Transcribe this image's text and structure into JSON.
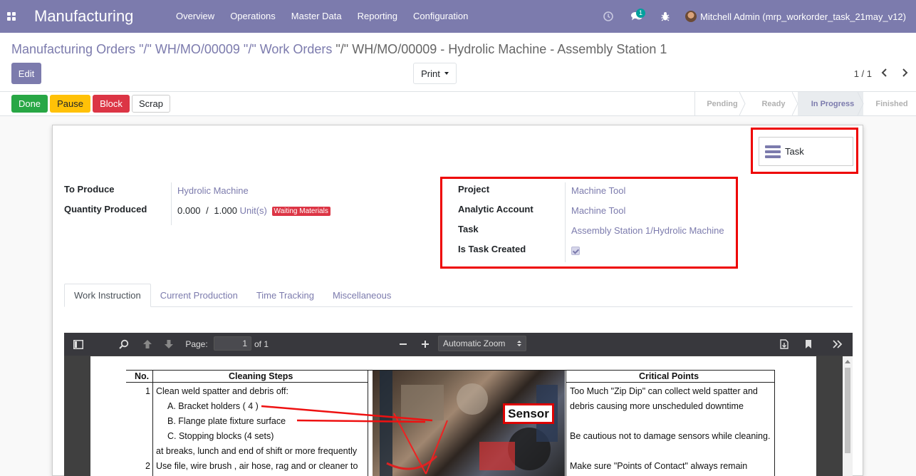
{
  "navbar": {
    "app_name": "Manufacturing",
    "menu": [
      "Overview",
      "Operations",
      "Master Data",
      "Reporting",
      "Configuration"
    ],
    "chat_count": "1",
    "user": "Mitchell Admin (mrp_workorder_task_21may_v12)"
  },
  "breadcrumb": {
    "part1": "Manufacturing Orders",
    "sep1": " \"/\" ",
    "part2": "WH/MO/00009",
    "sep2": " \"/\" ",
    "part3": "Work Orders",
    "sep3": " \"/\" ",
    "current": "WH/MO/00009 - Hydrolic Machine - Assembly Station 1"
  },
  "buttons": {
    "edit": "Edit",
    "print": "Print"
  },
  "pager": {
    "value": "1 / 1"
  },
  "status_buttons": {
    "done": "Done",
    "pause": "Pause",
    "block": "Block",
    "scrap": "Scrap"
  },
  "stages": [
    "Pending",
    "Ready",
    "In Progress",
    "Finished"
  ],
  "active_stage": "In Progress",
  "smart_button": {
    "label": "Task"
  },
  "form": {
    "to_produce_label": "To Produce",
    "to_produce_value": "Hydrolic Machine",
    "qty_label": "Quantity Produced",
    "qty_done": "0.000",
    "qty_sep": "/",
    "qty_total": "1.000",
    "qty_uom": "Unit(s)",
    "qty_badge": "Waiting Materials",
    "project_label": "Project",
    "project_value": "Machine Tool",
    "analytic_label": "Analytic Account",
    "analytic_value": "Machine Tool",
    "task_label": "Task",
    "task_value": "Assembly Station 1/Hydrolic Machine",
    "task_created_label": "Is Task Created",
    "task_created": true
  },
  "tabs": [
    "Work Instruction",
    "Current Production",
    "Time Tracking",
    "Miscellaneous"
  ],
  "pdf_viewer": {
    "page_label": "Page:",
    "page_value": "1",
    "page_of": "of 1",
    "zoom": "Automatic Zoom"
  },
  "document": {
    "col_no": "No.",
    "col_steps": "Cleaning Steps",
    "col_critical": "Critical Points",
    "row1_no": "1",
    "row1_lines": [
      "Clean weld spatter and debris off:",
      "A. Bracket holders ( 4 )",
      "B. Flange plate fixture surface",
      "C. Stopping blocks (4 sets)",
      "at breaks, lunch and end of shift or more frequently"
    ],
    "row2_no": "2",
    "row2_line": "Use file, wire brush , air hose, rag and or cleaner to",
    "photo_label": "Sensor",
    "critical_lines": [
      "Too Much \"Zip Dip\" can collect weld spatter and",
      "debris causing more unscheduled downtime",
      "Be cautious not to damage sensors while cleaning.",
      "Make sure \"Points of Contact\" always remain"
    ]
  },
  "colors": {
    "brand": "#7c7bad",
    "done": "#28a745",
    "pause": "#ffc107",
    "block": "#dc3545",
    "highlight": "#ee0000"
  }
}
